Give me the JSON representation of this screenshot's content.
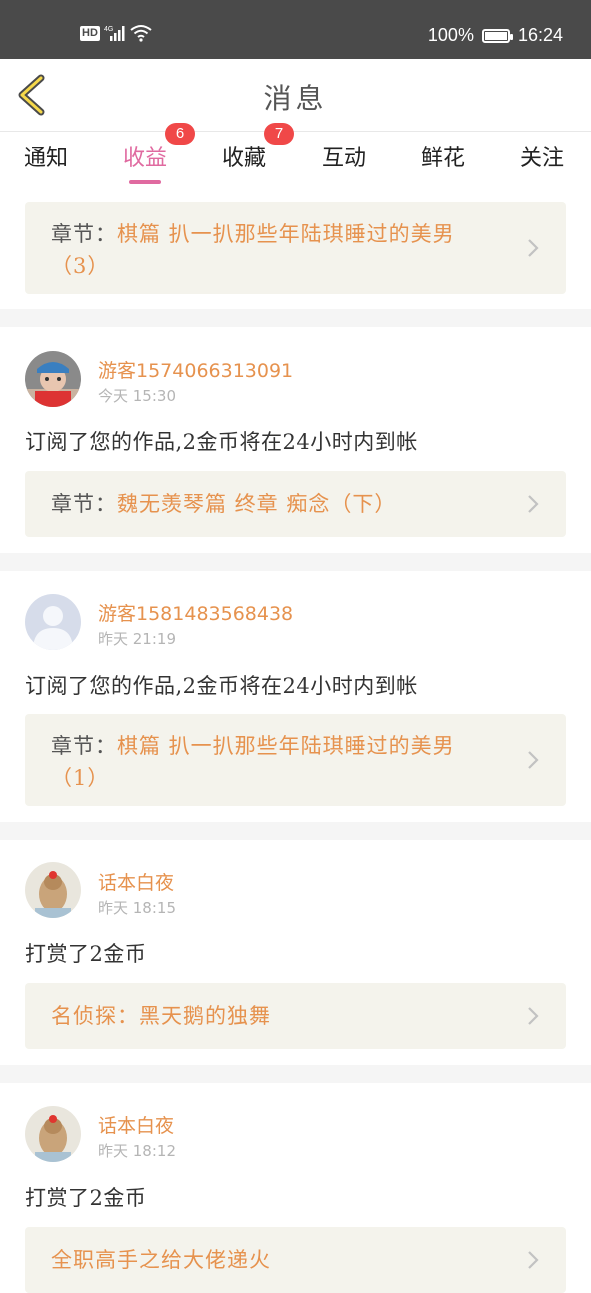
{
  "status_bar": {
    "network": "HD",
    "signal_label": "4G",
    "battery": "100%",
    "time": "16:24"
  },
  "header": {
    "title": "消息"
  },
  "tabs": [
    {
      "label": "通知"
    },
    {
      "label": "收益",
      "active": true,
      "badge": "6"
    },
    {
      "label": "收藏",
      "badge": "7"
    },
    {
      "label": "互动"
    },
    {
      "label": "鲜花"
    },
    {
      "label": "关注"
    }
  ],
  "top_card": {
    "prefix": "章节：",
    "title_line1": "棋篇 扒一扒那些年陆琪睡过的美男",
    "title_line2": "（3）"
  },
  "items": [
    {
      "user": "游客1574066313091",
      "time": "今天 15:30",
      "message": "订阅了您的作品,2金币将在24小时内到帐",
      "link_prefix": "章节：",
      "link_line1": "魏无羡琴篇 终章 痴念（下）",
      "link_line2": ""
    },
    {
      "user": "游客1581483568438",
      "time": "昨天 21:19",
      "message": "订阅了您的作品,2金币将在24小时内到帐",
      "link_prefix": "章节：",
      "link_line1": "棋篇 扒一扒那些年陆琪睡过的美男",
      "link_line2": "（1）"
    },
    {
      "user": "话本白夜",
      "time": "昨天 18:15",
      "message": "打赏了2金币",
      "link_prefix": "",
      "link_line1": "名侦探：黑天鹅的独舞",
      "link_line2": ""
    },
    {
      "user": "话本白夜",
      "time": "昨天 18:12",
      "message": "打赏了2金币",
      "link_prefix": "",
      "link_line1": "全职高手之给大佬递火",
      "link_line2": ""
    }
  ],
  "colors": {
    "accent": "#e06aa0",
    "orange": "#e6924e",
    "badge": "#f04848",
    "card_bg": "#f4f3ec"
  }
}
